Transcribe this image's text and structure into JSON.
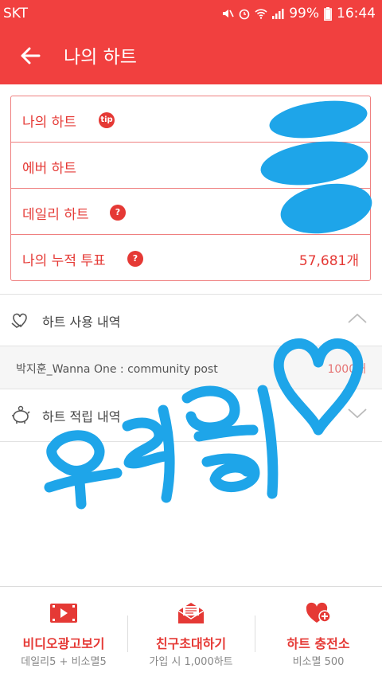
{
  "status": {
    "carrier": "SKT",
    "battery": "99%",
    "time": "16:44"
  },
  "header": {
    "title": "나의 하트"
  },
  "summary": {
    "rows": [
      {
        "label": "나의 하트",
        "badge": "tip",
        "value": ""
      },
      {
        "label": "에버 하트",
        "badge": "",
        "value": ""
      },
      {
        "label": "데일리 하트",
        "badge": "?",
        "value": ""
      },
      {
        "label": "나의 누적 투표",
        "badge": "?",
        "value": "57,681개"
      }
    ]
  },
  "usage": {
    "title": "하트 사용 내역",
    "items": [
      {
        "name": "박지훈_Wanna One : community post",
        "amount": "1000개"
      }
    ]
  },
  "earn": {
    "title": "하트 적립 내역"
  },
  "bottom": {
    "items": [
      {
        "label": "비디오광고보기",
        "sub": "데일리5 + 비소멸5",
        "icon": "video-icon"
      },
      {
        "label": "친구초대하기",
        "sub": "가입 시 1,000하트",
        "icon": "mail-icon"
      },
      {
        "label": "하트 충전소",
        "sub": "비소멸 500",
        "icon": "heart-plus-icon"
      }
    ]
  },
  "colors": {
    "primary": "#f1403f",
    "accent": "#e53935",
    "scribble": "#1ea5e9"
  }
}
